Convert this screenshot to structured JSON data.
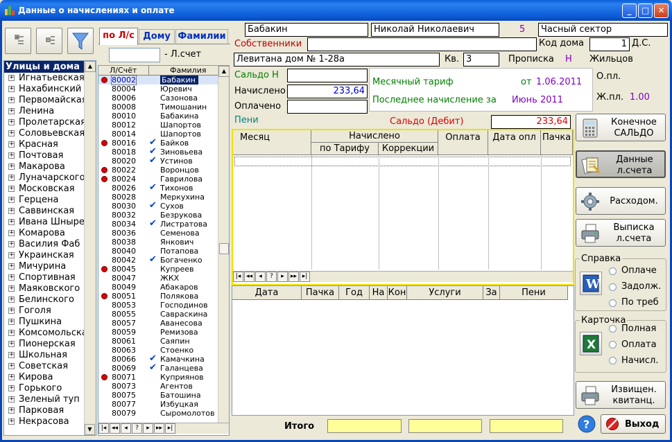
{
  "window": {
    "title": "Данные о начислениях и оплате"
  },
  "tabs": [
    {
      "label": "по Л/с"
    },
    {
      "label": "Дому"
    },
    {
      "label": "Фамилии"
    }
  ],
  "account_search": {
    "label": "- Л.счет",
    "value": ""
  },
  "streets": {
    "header": "Улицы и дома",
    "items": [
      "Игнатьевская",
      "Нахабинский",
      "Первомайская",
      "Ленина",
      "Пролетарская",
      "Соловьевская",
      "Красная",
      "Почтовая",
      "Макарова",
      "Луначарского",
      "Московская",
      "Герцена",
      "Саввинская",
      "Ивана Шныре",
      "Комарова",
      "Василия Фаб",
      "Украинская",
      "Мичурина",
      "Спортивная",
      "Маяковского",
      "Белинского",
      "Гоголя",
      "Пушкина",
      "Комсомольская",
      "Пионерская",
      "Школьная",
      "Советская",
      "Кирова",
      "Горького",
      "Зеленый туп",
      "Парковая",
      "Некрасова"
    ]
  },
  "accounts": {
    "col_account": "Л/Счёт",
    "col_name": "Фамилия",
    "rows": [
      {
        "n": "80002",
        "f": "Бабакин",
        "dot": true,
        "chk": false
      },
      {
        "n": "80004",
        "f": "Юревич",
        "dot": false,
        "chk": false
      },
      {
        "n": "80006",
        "f": "Сазонова",
        "dot": false,
        "chk": false
      },
      {
        "n": "80008",
        "f": "Тимошанин",
        "dot": false,
        "chk": false
      },
      {
        "n": "80010",
        "f": "Бабакина",
        "dot": false,
        "chk": false
      },
      {
        "n": "80012",
        "f": "Шапортов",
        "dot": false,
        "chk": false
      },
      {
        "n": "80014",
        "f": "Шапортов",
        "dot": false,
        "chk": false
      },
      {
        "n": "80016",
        "f": "Байков",
        "dot": true,
        "chk": true
      },
      {
        "n": "80018",
        "f": "Зиновьева",
        "dot": false,
        "chk": true
      },
      {
        "n": "80020",
        "f": "Устинов",
        "dot": false,
        "chk": true
      },
      {
        "n": "80022",
        "f": "Воронцов",
        "dot": true,
        "chk": false
      },
      {
        "n": "80024",
        "f": "Гаврилова",
        "dot": true,
        "chk": false
      },
      {
        "n": "80026",
        "f": "Тихонов",
        "dot": false,
        "chk": true
      },
      {
        "n": "80028",
        "f": "Меркухина",
        "dot": false,
        "chk": false
      },
      {
        "n": "80030",
        "f": "Сухов",
        "dot": false,
        "chk": true
      },
      {
        "n": "80032",
        "f": "Безрукова",
        "dot": false,
        "chk": false
      },
      {
        "n": "80034",
        "f": "Листратова",
        "dot": false,
        "chk": true
      },
      {
        "n": "80036",
        "f": "Семенова",
        "dot": false,
        "chk": false
      },
      {
        "n": "80038",
        "f": "Янкович",
        "dot": false,
        "chk": false
      },
      {
        "n": "80040",
        "f": "Потапова",
        "dot": false,
        "chk": false
      },
      {
        "n": "80042",
        "f": "Богаченко",
        "dot": false,
        "chk": true
      },
      {
        "n": "80045",
        "f": "Купреев",
        "dot": true,
        "chk": false
      },
      {
        "n": "80047",
        "f": "ЖКХ",
        "dot": false,
        "chk": false
      },
      {
        "n": "80049",
        "f": "Абакаров",
        "dot": false,
        "chk": false
      },
      {
        "n": "80051",
        "f": "Полякова",
        "dot": true,
        "chk": false
      },
      {
        "n": "80053",
        "f": "Господинов",
        "dot": false,
        "chk": false
      },
      {
        "n": "80055",
        "f": "Савраскина",
        "dot": false,
        "chk": false
      },
      {
        "n": "80057",
        "f": "Аванесова",
        "dot": false,
        "chk": false
      },
      {
        "n": "80059",
        "f": "Ремизова",
        "dot": false,
        "chk": false
      },
      {
        "n": "80061",
        "f": "Саяпин",
        "dot": false,
        "chk": false
      },
      {
        "n": "80063",
        "f": "Стоенко",
        "dot": false,
        "chk": false
      },
      {
        "n": "80066",
        "f": "Камачкина",
        "dot": false,
        "chk": true
      },
      {
        "n": "80069",
        "f": "Галанцева",
        "dot": false,
        "chk": true
      },
      {
        "n": "80071",
        "f": "Куприянов",
        "dot": true,
        "chk": false
      },
      {
        "n": "80073",
        "f": "Агентов",
        "dot": false,
        "chk": false
      },
      {
        "n": "80075",
        "f": "Батошина",
        "dot": false,
        "chk": false
      },
      {
        "n": "80077",
        "f": "Избуцкая",
        "dot": false,
        "chk": false
      },
      {
        "n": "80079",
        "f": "Сыромолотов",
        "dot": false,
        "chk": false
      }
    ]
  },
  "info": {
    "surname": "Бабакин",
    "name": "Николай Николаевич",
    "num": "5",
    "sector": "Часный сектор",
    "owners_label": "Собственники",
    "owners_value": "",
    "house_code_label": "Код дома",
    "house_code": "1",
    "ds_label": "Д.С.",
    "address": "Левитана дом № 1-28а",
    "kv_label": "Кв.",
    "kv": "3",
    "propiska_label": "Прописка",
    "propiska": "Н",
    "residents_label": "Жильцов",
    "saldo_label": "Сальдо Н",
    "saldo": "",
    "accrued_label": "Начислено",
    "accrued": "233,64",
    "paid_label": "Оплачено",
    "paid": "",
    "peni_label": "Пени",
    "tariff_label": "Месячный тариф",
    "tariff_from": "от",
    "tariff_date": "1.06.2011",
    "last_accrual_label": "Последнее начисление за",
    "last_accrual": "Июнь 2011",
    "opl_label": "О.пл.",
    "zhpl_label": "Ж.пл.",
    "zhpl": "1.00",
    "saldo_debit_label": "Сальдо (Дебит)",
    "saldo_debit": "233,64"
  },
  "grid1": {
    "month": "Месяц",
    "accrued": "Начислено",
    "by_tariff": "по Тарифу",
    "corrections": "Коррекции",
    "payment": "Оплата",
    "pay_date": "Дата опл",
    "pack": "Пачка"
  },
  "grid2": {
    "date": "Дата",
    "pack": "Пачка",
    "year": "Год",
    "na": "На",
    "kon": "Кон",
    "services": "Услуги",
    "za": "За",
    "peni": "Пени"
  },
  "total_label": "Итого",
  "buttons": {
    "final_saldo": [
      "Конечное",
      "САЛЬДО"
    ],
    "account_data": [
      "Данные",
      "л.счета"
    ],
    "expense": "Расходом.",
    "statement": [
      "Выписка",
      "л.счета"
    ],
    "notice": [
      "Извищен.",
      "квитанц."
    ],
    "exit": "Выход"
  },
  "spravka": {
    "title": "Справка",
    "options": [
      "Оплаче",
      "Задолж.",
      "По треб"
    ]
  },
  "kartochka": {
    "title": "Карточка",
    "options": [
      "Полная",
      "Оплата",
      "Начисл."
    ]
  }
}
